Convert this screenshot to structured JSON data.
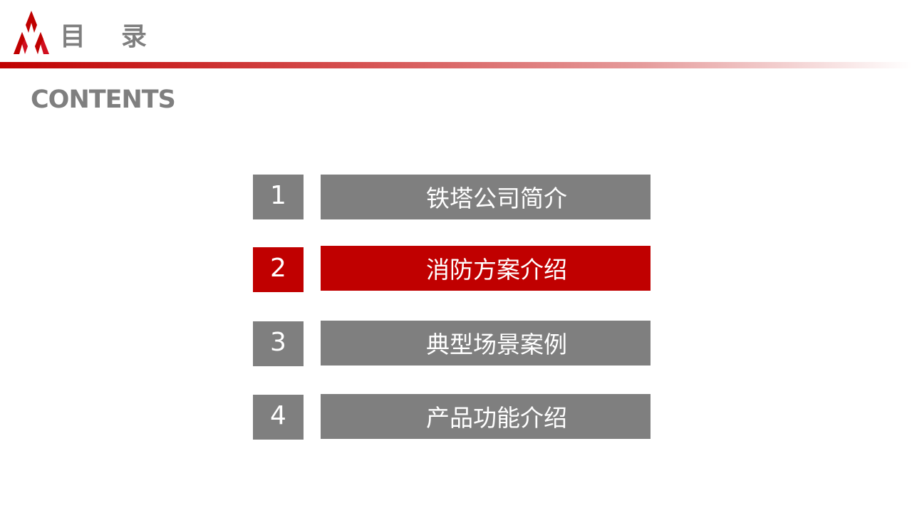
{
  "header": {
    "title_chars": [
      "目",
      "录"
    ],
    "subtitle": "CONTENTS",
    "logo": "company-logo-icon"
  },
  "colors": {
    "accent": "#c00000",
    "neutral": "#7f7f7f",
    "text_on_box": "#ffffff",
    "background": "#ffffff"
  },
  "toc": {
    "items": [
      {
        "number": "1",
        "label": "铁塔公司简介",
        "active": false
      },
      {
        "number": "2",
        "label": "消防方案介绍",
        "active": true
      },
      {
        "number": "3",
        "label": "典型场景案例",
        "active": false
      },
      {
        "number": "4",
        "label": "产品功能介绍",
        "active": false
      }
    ]
  }
}
